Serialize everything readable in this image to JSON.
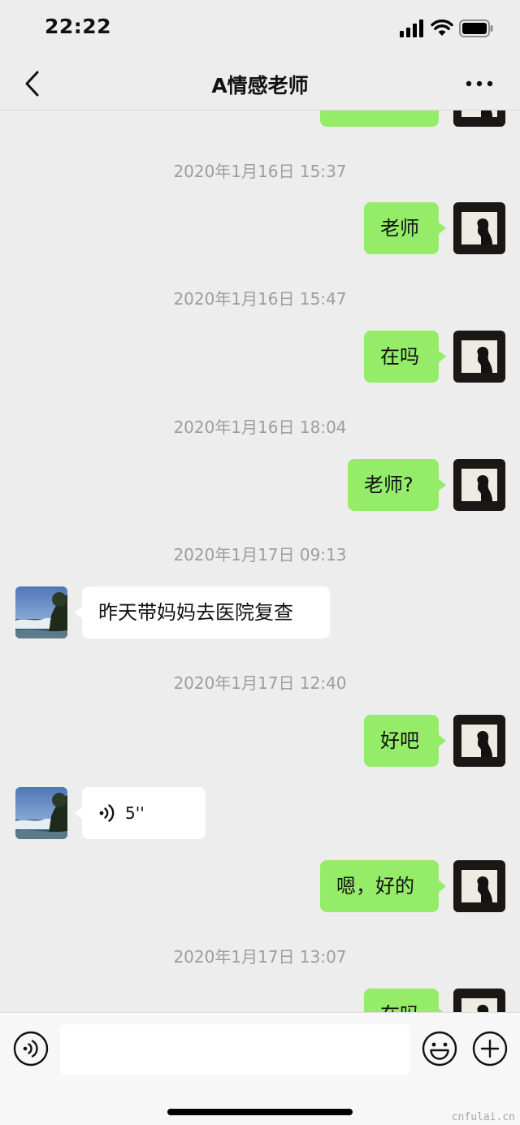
{
  "status_bar": {
    "time": "22:22"
  },
  "nav": {
    "title": "A情感老师"
  },
  "messages": {
    "partial_top": {
      "text": ""
    },
    "ts1": "2020年1月16日 15:37",
    "m1": "老师",
    "ts2": "2020年1月16日 15:47",
    "m2": "在吗",
    "ts3": "2020年1月16日 18:04",
    "m3": "老师?",
    "ts4": "2020年1月17日 09:13",
    "m4": "昨天带妈妈去医院复查",
    "ts5": "2020年1月17日 12:40",
    "m5": "好吧",
    "m6_voice_duration": "5''",
    "m7": "嗯，好的",
    "ts6": "2020年1月17日 13:07",
    "m8_partial": "在吗"
  },
  "input_bar": {
    "placeholder": ""
  },
  "watermark": "cnfulai.cn",
  "colors": {
    "outgoing_bubble": "#95ec69",
    "incoming_bubble": "#ffffff",
    "background": "#ededed"
  },
  "icons": [
    "back-icon",
    "more-icon",
    "signal-icon",
    "wifi-icon",
    "battery-icon",
    "voice-icon",
    "emoji-icon",
    "plus-icon"
  ]
}
